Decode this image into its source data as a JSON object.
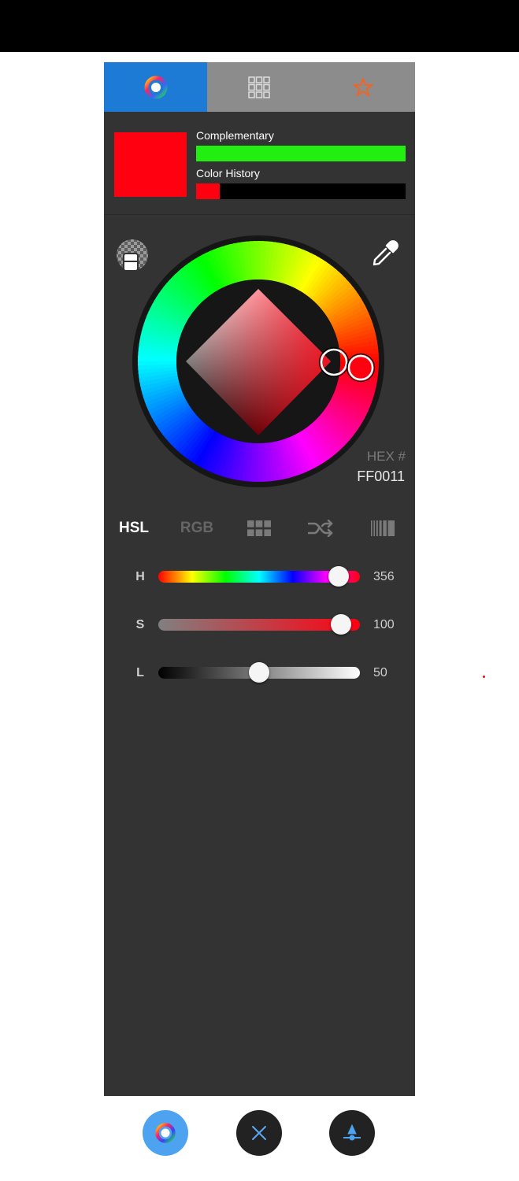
{
  "colors": {
    "current": "#ff0011",
    "complementary": "#22ee11",
    "history_chip": "#ff0011",
    "active_tab": "#1d7bd6",
    "star": "#f06428",
    "fab_blue": "#4da3f0",
    "close_x": "#5aa8f5"
  },
  "tabs": [
    {
      "icon": "color-wheel-icon",
      "active": true
    },
    {
      "icon": "grid-icon",
      "active": false
    },
    {
      "icon": "star-icon",
      "active": false
    }
  ],
  "preview": {
    "complementary_label": "Complementary",
    "history_label": "Color History"
  },
  "picker": {
    "hue_degrees": 356,
    "hex_title": "HEX #",
    "hex_value": "FF0011"
  },
  "modes": {
    "hsl": "HSL",
    "rgb": "RGB",
    "icons": [
      "palette-grid-icon",
      "shuffle-icon",
      "strips-icon"
    ]
  },
  "sliders": [
    {
      "label": "H",
      "value": "356",
      "fraction": 0.94
    },
    {
      "label": "S",
      "value": "100",
      "fraction": 0.95
    },
    {
      "label": "L",
      "value": "50",
      "fraction": 0.5
    }
  ],
  "bottom_actions": [
    "color-wheel-icon",
    "close-icon",
    "confirm-icon"
  ]
}
